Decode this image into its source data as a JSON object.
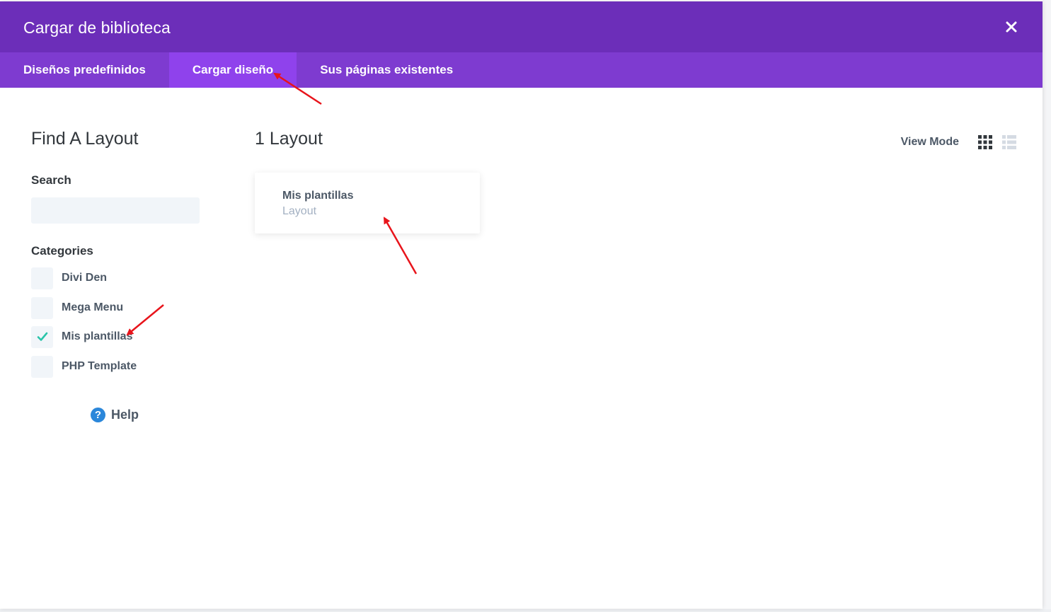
{
  "modal": {
    "title": "Cargar de biblioteca",
    "close_icon": "close-icon"
  },
  "tabs": [
    {
      "label": "Diseños predefinidos",
      "active": false
    },
    {
      "label": "Cargar diseño",
      "active": true
    },
    {
      "label": "Sus páginas existentes",
      "active": false
    }
  ],
  "sidebar": {
    "title": "Find A Layout",
    "search_label": "Search",
    "search_value": "",
    "categories_label": "Categories",
    "categories": [
      {
        "label": "Divi Den",
        "checked": false
      },
      {
        "label": "Mega Menu",
        "checked": false
      },
      {
        "label": "Mis plantillas",
        "checked": true
      },
      {
        "label": "PHP Template",
        "checked": false
      }
    ],
    "help_label": "Help",
    "help_icon": "question-circle-icon"
  },
  "main": {
    "count_title": "1 Layout",
    "view_mode_label": "View Mode",
    "view_modes": [
      "grid-icon",
      "list-icon"
    ],
    "active_view_mode": "grid-icon",
    "layouts": [
      {
        "title": "Mis plantillas",
        "type": "Layout"
      }
    ]
  },
  "colors": {
    "header": "#6c2eb9",
    "tabs_bar": "#7e3bd0",
    "tab_active": "#8f42ec",
    "checkmark": "#29c4a9",
    "help_icon": "#2b87da",
    "annotation_arrow": "#e8141b"
  }
}
